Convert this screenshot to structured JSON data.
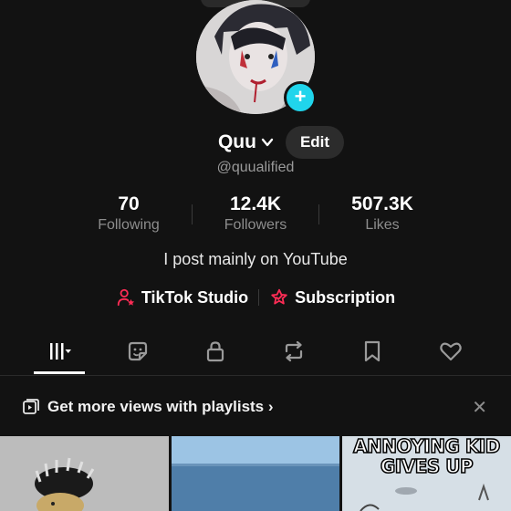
{
  "profile": {
    "name": "Quu",
    "handle": "@quualified",
    "edit_label": "Edit",
    "bio": "I post mainly on YouTube"
  },
  "stats": [
    {
      "value": "70",
      "label": "Following"
    },
    {
      "value": "12.4K",
      "label": "Followers"
    },
    {
      "value": "507.3K",
      "label": "Likes"
    }
  ],
  "links": {
    "studio": "TikTok Studio",
    "subscription": "Subscription"
  },
  "tabs": [
    {
      "icon": "grid-icon",
      "active": true
    },
    {
      "icon": "sticker-icon",
      "active": false
    },
    {
      "icon": "lock-icon",
      "active": false
    },
    {
      "icon": "repost-icon",
      "active": false
    },
    {
      "icon": "bookmark-icon",
      "active": false
    },
    {
      "icon": "heart-icon",
      "active": false
    }
  ],
  "playlist_prompt": {
    "text": "Get more views with playlists ›"
  },
  "thumbnails": [
    {
      "caption": ""
    },
    {
      "caption": ""
    },
    {
      "caption": "ANNOYING KID\nGIVES UP"
    }
  ],
  "colors": {
    "background": "#121212",
    "accent_cyan": "#20d5ec",
    "accent_pink": "#fe2c55",
    "muted_text": "#8d8d8d"
  }
}
